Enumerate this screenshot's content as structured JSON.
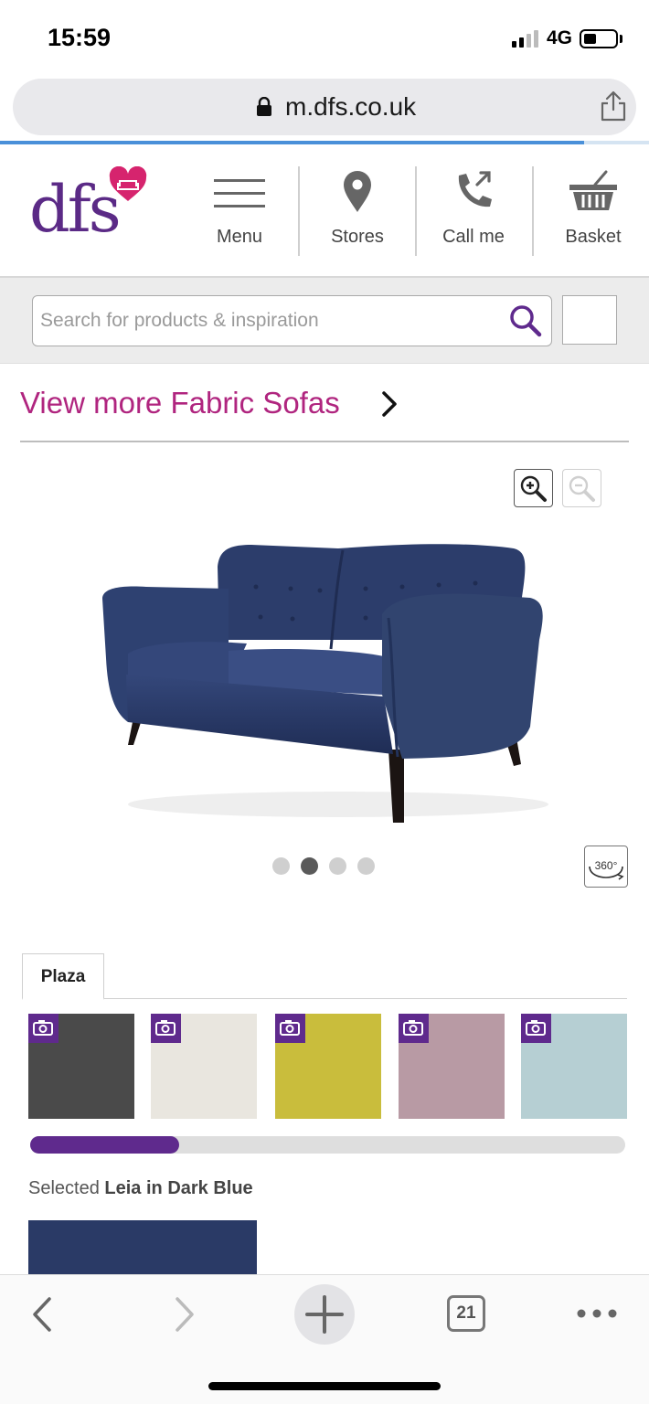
{
  "status_bar": {
    "time": "15:59",
    "network": "4G",
    "signal_bars_active": 2,
    "signal_bars_total": 4,
    "battery_level": 0.3
  },
  "browser": {
    "url": "m.dfs.co.uk",
    "load_progress": 0.9
  },
  "header": {
    "logo_text": "dfs",
    "nav": [
      {
        "label": "Menu",
        "icon": "hamburger-icon"
      },
      {
        "label": "Stores",
        "icon": "map-pin-icon"
      },
      {
        "label": "Call me",
        "icon": "phone-callback-icon"
      },
      {
        "label": "Basket",
        "icon": "basket-icon"
      }
    ]
  },
  "search": {
    "placeholder": "Search for products & inspiration"
  },
  "breadcrumb": {
    "view_more": "View more Fabric Sofas"
  },
  "gallery": {
    "dot_count": 4,
    "active_dot": 1,
    "view_360_label": "360°"
  },
  "fabric": {
    "tab_label": "Plaza",
    "swatches": [
      {
        "name": "charcoal",
        "color": "#4a4a4a"
      },
      {
        "name": "cream",
        "color": "#e9e6df"
      },
      {
        "name": "mustard",
        "color": "#c9bd3c"
      },
      {
        "name": "blush",
        "color": "#b89aa4"
      },
      {
        "name": "duck-egg",
        "color": "#b6cfd3"
      }
    ],
    "scroll_fraction": 0.25,
    "selected_prefix": "Selected",
    "selected_name": "Leia in Dark Blue",
    "selected_color": "#2a3a66"
  },
  "toolbar": {
    "tab_count": "21"
  },
  "colors": {
    "brand_purple": "#5f2a8d",
    "link_magenta": "#b0257f"
  }
}
